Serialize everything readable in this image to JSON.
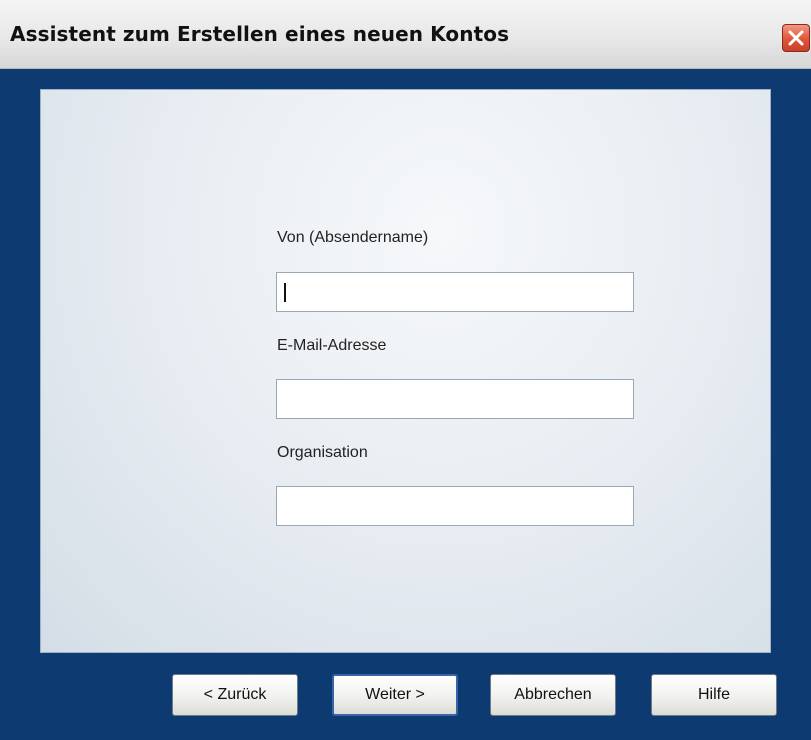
{
  "window": {
    "title": "Assistent zum Erstellen eines neuen Kontos",
    "close_icon": "close-icon"
  },
  "form": {
    "sender_name": {
      "label": "Von (Absendername)",
      "value": ""
    },
    "email": {
      "label": "E-Mail-Adresse",
      "value": ""
    },
    "organization": {
      "label": "Organisation",
      "value": ""
    }
  },
  "buttons": {
    "back": "< Zurück",
    "next": "Weiter >",
    "cancel": "Abbrechen",
    "help": "Hilfe"
  },
  "colors": {
    "frame": "#0e3a72",
    "close_button": "#e0553a"
  }
}
